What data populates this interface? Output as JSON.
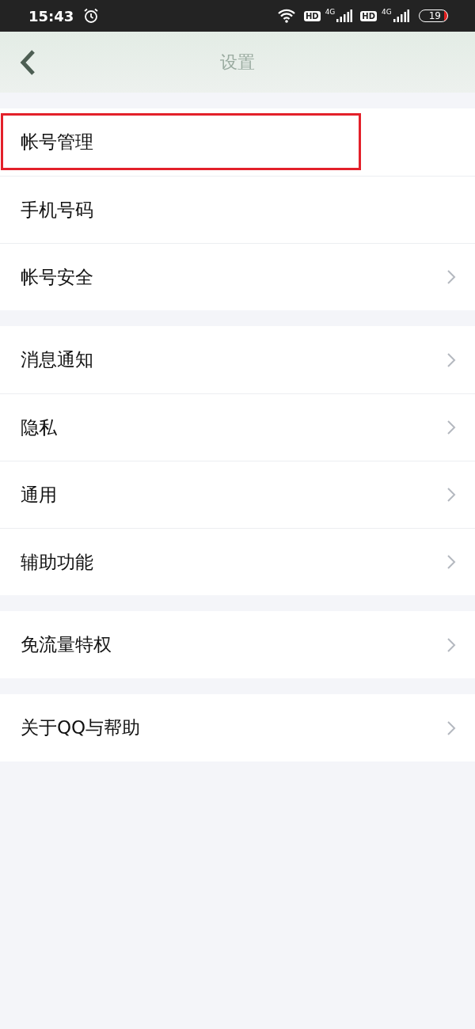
{
  "status_bar": {
    "time": "15:43",
    "sims": [
      {
        "badge": "HD",
        "network": "4G"
      },
      {
        "badge": "HD",
        "network": "4G"
      }
    ],
    "battery": "19"
  },
  "header": {
    "title": "设置"
  },
  "groups": [
    {
      "items": [
        {
          "label": "帐号管理",
          "chevron": false,
          "highlighted": true
        },
        {
          "label": "手机号码",
          "chevron": false,
          "highlighted": false
        },
        {
          "label": "帐号安全",
          "chevron": true,
          "highlighted": false
        }
      ]
    },
    {
      "items": [
        {
          "label": "消息通知",
          "chevron": true,
          "highlighted": false
        },
        {
          "label": "隐私",
          "chevron": true,
          "highlighted": false
        },
        {
          "label": "通用",
          "chevron": true,
          "highlighted": false
        },
        {
          "label": "辅助功能",
          "chevron": true,
          "highlighted": false
        }
      ]
    },
    {
      "items": [
        {
          "label": "免流量特权",
          "chevron": true,
          "highlighted": false
        }
      ]
    },
    {
      "items": [
        {
          "label": "关于QQ与帮助",
          "chevron": true,
          "highlighted": false
        }
      ]
    }
  ]
}
